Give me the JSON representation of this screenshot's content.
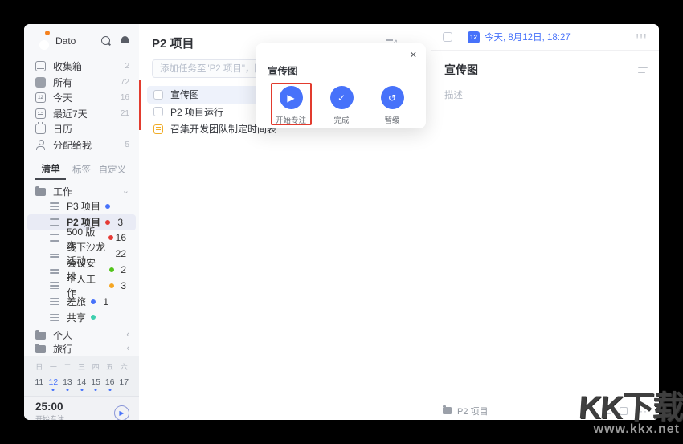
{
  "colors": {
    "accent": "#4772fa",
    "annotation_red": "#e23b2e",
    "note_orange": "#f0ad2a"
  },
  "sidebar": {
    "user": "Dato",
    "nav": [
      {
        "label": "收集箱",
        "count": "2"
      },
      {
        "label": "所有",
        "count": "72"
      },
      {
        "label": "今天",
        "count": "16"
      },
      {
        "label": "最近7天",
        "count": "21"
      },
      {
        "label": "日历",
        "count": ""
      },
      {
        "label": "分配给我",
        "count": "5"
      }
    ],
    "today_icon_text": "12",
    "tabs": [
      {
        "label": "清单"
      },
      {
        "label": "标签"
      },
      {
        "label": "自定义"
      }
    ],
    "work_folder": {
      "label": "工作",
      "chevron": "⌄"
    },
    "lists": [
      {
        "label": "P3 项目",
        "dot": "#4772fa",
        "count": ""
      },
      {
        "label": "P2 项目",
        "dot": "#e53a35",
        "count": "3"
      },
      {
        "label": "500 版本",
        "dot": "#e53a35",
        "count": "16"
      },
      {
        "label": "线下沙龙活动",
        "dot": "",
        "count": "22"
      },
      {
        "label": "会议安排",
        "dot": "#52c41a",
        "count": "2"
      },
      {
        "label": "个人工作",
        "dot": "#f5a623",
        "count": "3"
      },
      {
        "label": "差旅",
        "dot": "#4772fa",
        "count": "1"
      },
      {
        "label": "共享",
        "dot": "#3ecfae",
        "count": ""
      }
    ],
    "bottom_folders": [
      {
        "label": "个人",
        "chevron": "‹"
      },
      {
        "label": "旅行",
        "chevron": "‹"
      }
    ],
    "calendar": {
      "weekdays": [
        "日",
        "一",
        "二",
        "三",
        "四",
        "五",
        "六"
      ],
      "days": [
        {
          "d": "11",
          "color": "#5d646e",
          "dot": ""
        },
        {
          "d": "12",
          "color": "#4772fa",
          "dot": "#4772fa"
        },
        {
          "d": "13",
          "color": "#5d646e",
          "dot": "#4772fa"
        },
        {
          "d": "14",
          "color": "#5d646e",
          "dot": "#4772fa"
        },
        {
          "d": "15",
          "color": "#5d646e",
          "dot": "#4772fa"
        },
        {
          "d": "16",
          "color": "#5d646e",
          "dot": "#4772fa"
        },
        {
          "d": "17",
          "color": "#5d646e",
          "dot": ""
        }
      ]
    },
    "timer": {
      "time": "25:00",
      "label": "开始专注",
      "play_icon": "▶"
    }
  },
  "list_panel": {
    "title": "P2 项目",
    "more_icon": "···",
    "add_placeholder": "添加任务至\"P2 项目\"，回车即可保存",
    "tasks": [
      {
        "title": "宣传图"
      },
      {
        "title": "P2 项目运行"
      },
      {
        "title": "召集开发团队制定时间表"
      }
    ]
  },
  "dialog": {
    "title": "宣传图",
    "close_icon": "✕",
    "actions": [
      {
        "label": "开始专注",
        "icon": "▶"
      },
      {
        "label": "完成",
        "icon": "✓"
      },
      {
        "label": "暂缓",
        "icon": "↺"
      }
    ]
  },
  "detail_panel": {
    "date_badge": "12",
    "date_text": "今天, 8月12日, 18:27",
    "priority_icon": "!!!",
    "title": "宣传图",
    "desc_placeholder": "描述",
    "project": "P2 项目",
    "more_icon": "···"
  },
  "watermark": {
    "logo": "KK下载",
    "url": "www.kkx.net"
  }
}
